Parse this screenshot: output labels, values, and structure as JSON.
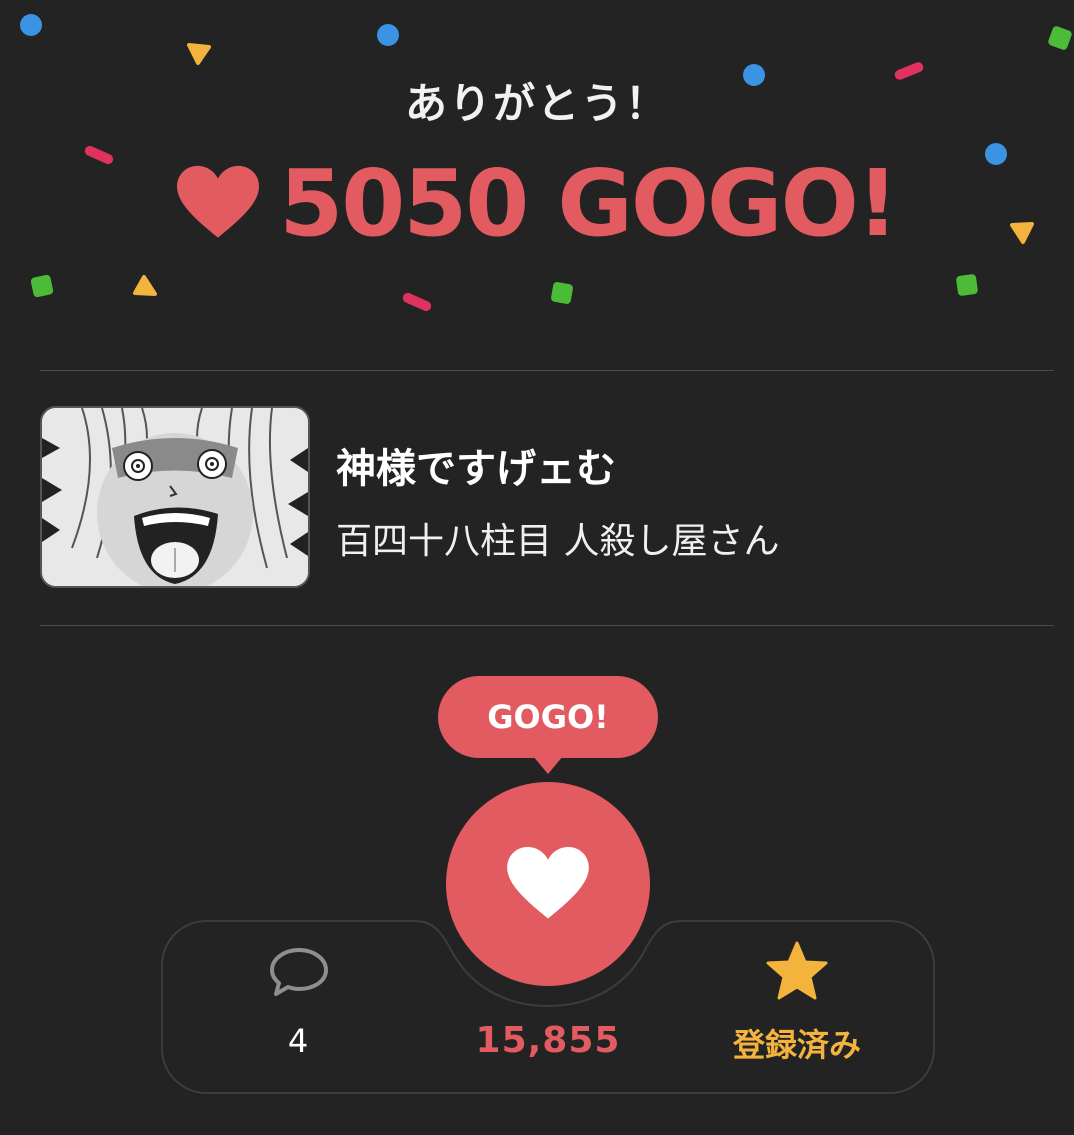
{
  "header": {
    "thanks": "ありがとう！",
    "headline": "5050 GOGO!",
    "heart_icon": "heart-icon"
  },
  "work": {
    "thumbnail_icon": "manga-thumbnail",
    "title": "神様ですげェむ",
    "subtitle": "百四十八柱目 人殺し屋さん"
  },
  "actions": {
    "bubble_label": "GOGO!",
    "comment_icon": "speech-bubble-icon",
    "comment_count": "4",
    "gogo_count": "15,855",
    "bookmark_icon": "star-icon",
    "bookmark_label": "登録済み"
  },
  "colors": {
    "background": "#232323",
    "accent": "#e15b60",
    "bookmark": "#f3b33d",
    "confetti_blue": "#3b93e4",
    "confetti_green": "#4cbc38",
    "confetti_yellow": "#f3b33d",
    "confetti_pink": "#e0325f"
  }
}
